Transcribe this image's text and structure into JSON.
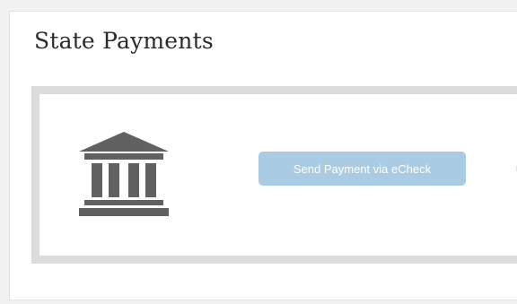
{
  "page": {
    "title": "State Payments"
  },
  "payment_option": {
    "icon": "bank-icon",
    "button_label": "Send Payment via eCheck"
  },
  "colors": {
    "button_bg": "#a9cbe3",
    "icon": "#616161",
    "card_border": "#dcdcdc"
  }
}
